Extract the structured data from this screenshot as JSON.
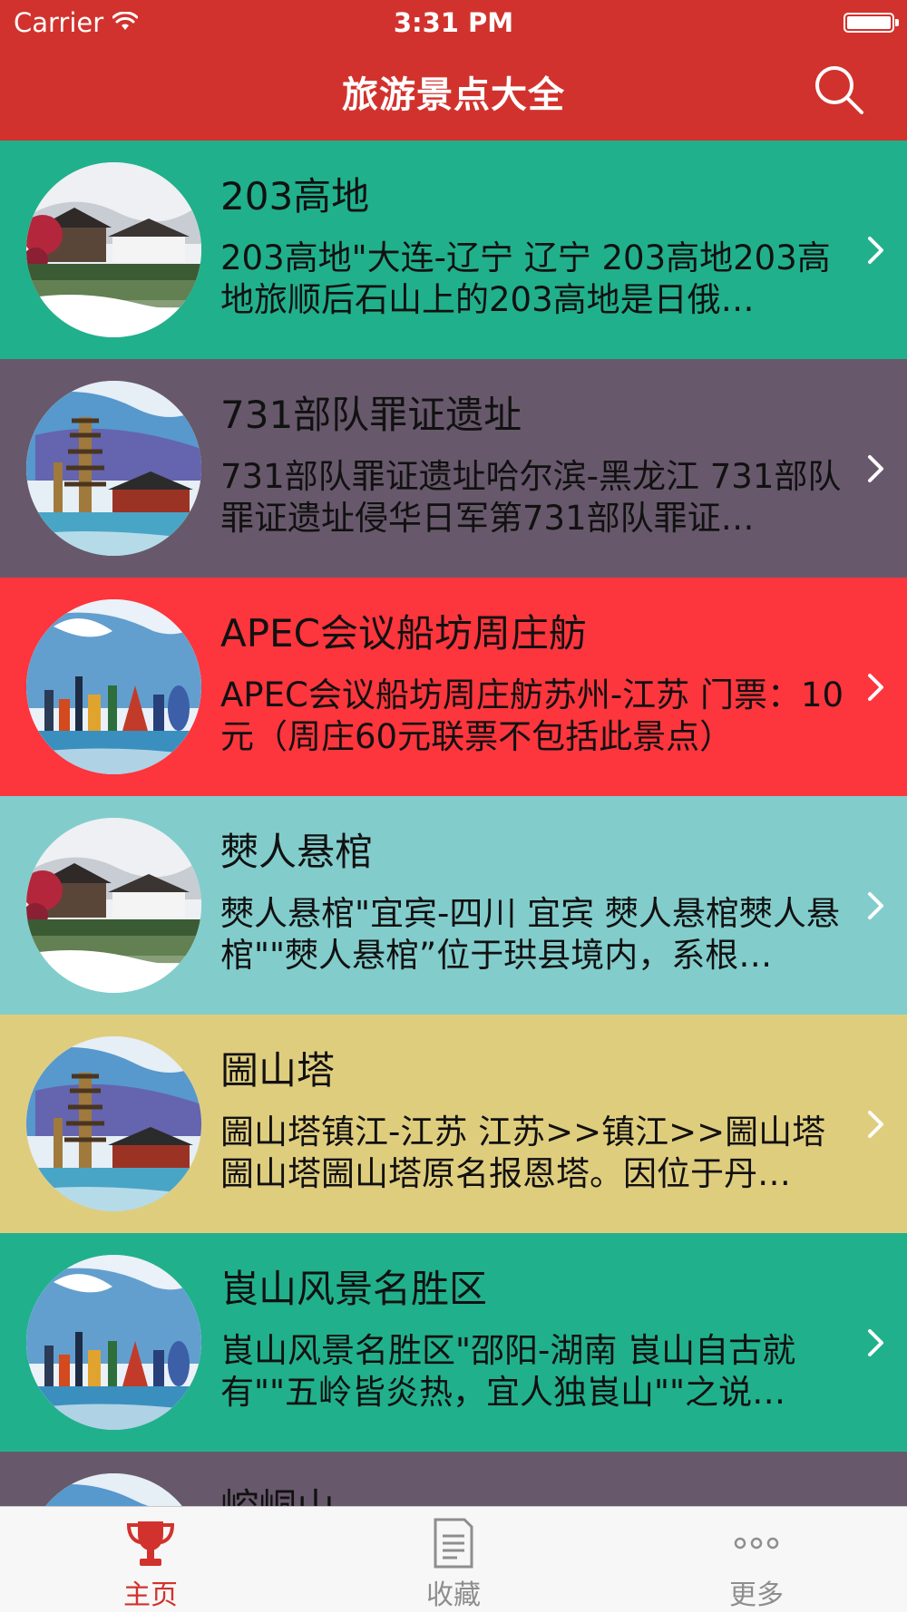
{
  "status_bar": {
    "carrier": "Carrier",
    "time": "3:31 PM"
  },
  "nav": {
    "title": "旅游景点大全",
    "search_icon": "search-icon"
  },
  "list": [
    {
      "title": "203高地",
      "description": "203高地\"大连-辽宁 辽宁 203高地203高地旅顺后石山上的203高地是日俄…",
      "bg": "#21b08c",
      "thumb": "garden"
    },
    {
      "title": "731部队罪证遗址",
      "description": "731部队罪证遗址哈尔滨-黑龙江 731部队罪证遗址侵华日军第731部队罪证…",
      "bg": "#67596b",
      "thumb": "pagoda"
    },
    {
      "title": "APEC会议船坊周庄舫",
      "description": "APEC会议船坊周庄舫苏州-江苏 门票：10元（周庄60元联票不包括此景点）",
      "bg": "#fd353d",
      "thumb": "city"
    },
    {
      "title": "僰人悬棺",
      "description": "僰人悬棺\"宜宾-四川 宜宾 僰人悬棺僰人悬棺\"\"僰人悬棺”位于珙县境内，系根…",
      "bg": "#82cdcc",
      "thumb": "garden"
    },
    {
      "title": "圌山塔",
      "description": "圌山塔镇江-江苏 江苏>>镇江>>圌山塔圌山塔圌山塔原名报恩塔。因位于丹…",
      "bg": "#dfcd7e",
      "thumb": "pagoda"
    },
    {
      "title": "崀山风景名胜区",
      "description": "崀山风景名胜区\"邵阳-湖南 崀山自古就有\"\"五岭皆炎热，宜人独崀山\"\"之说…",
      "bg": "#21b08c",
      "thumb": "city"
    },
    {
      "title": "崆峒山",
      "description": "",
      "bg": "#67596b",
      "thumb": "pagoda"
    }
  ],
  "tabbar": {
    "tabs": [
      {
        "label": "主页",
        "icon": "trophy-icon",
        "active": true
      },
      {
        "label": "收藏",
        "icon": "document-icon",
        "active": false
      },
      {
        "label": "更多",
        "icon": "more-dots-icon",
        "active": false
      }
    ]
  },
  "colors": {
    "header": "#d2322d",
    "active_tab": "#d2322d",
    "inactive_tab": "#8e8e8e"
  }
}
